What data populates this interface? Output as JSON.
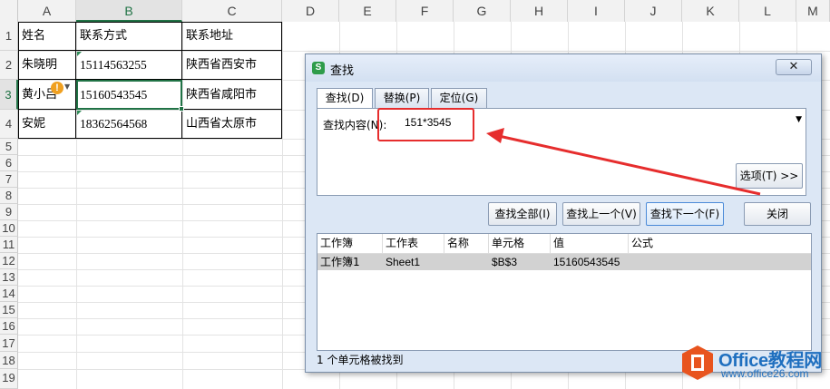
{
  "sheet": {
    "columns": [
      "A",
      "B",
      "C",
      "D",
      "E",
      "F",
      "G",
      "H",
      "I",
      "J",
      "K",
      "L",
      "M"
    ],
    "rows": [
      "1",
      "2",
      "3",
      "4",
      "5",
      "6",
      "7",
      "8",
      "9",
      "10",
      "11",
      "12",
      "13",
      "14",
      "15",
      "16",
      "17",
      "18",
      "19"
    ],
    "data": [
      [
        "姓名",
        "联系方式",
        "联系地址"
      ],
      [
        "朱晓明",
        "15114563255",
        "陕西省西安市"
      ],
      [
        "黄小吕",
        "15160543545",
        "陕西省咸阳市"
      ],
      [
        "安妮",
        "18362564568",
        "山西省太原市"
      ]
    ],
    "warning_icon": "!",
    "active_cell": "B3"
  },
  "dialog": {
    "title": "查找",
    "logo": "S",
    "close_glyph": "✕",
    "tabs": [
      "查找(D)",
      "替换(P)",
      "定位(G)"
    ],
    "active_tab": "查找(D)",
    "find_label": "查找内容(N):",
    "find_value": "151*3545",
    "options_button": "选项(T) >>",
    "buttons": {
      "find_all": "查找全部(I)",
      "find_prev": "查找上一个(V)",
      "find_next": "查找下一个(F)",
      "close": "关闭"
    },
    "results": {
      "headers": [
        "工作簿",
        "工作表",
        "名称",
        "单元格",
        "值",
        "公式"
      ],
      "rows": [
        [
          "工作簿1",
          "Sheet1",
          "",
          "$B$3",
          "15160543545",
          ""
        ]
      ]
    },
    "status": "1 个单元格被找到"
  },
  "annotation": {
    "color": "#e62d2d"
  },
  "watermark": {
    "brand": "Office教程网",
    "url": "www.office26.com"
  }
}
